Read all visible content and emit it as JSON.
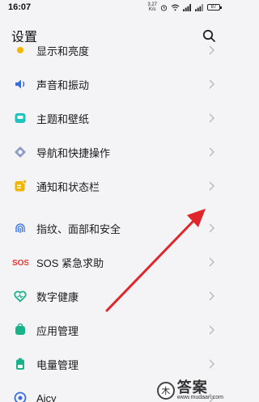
{
  "status_bar": {
    "time": "16:07",
    "net_speed_value": "3.27",
    "net_speed_unit": "K/s",
    "battery": "87"
  },
  "header": {
    "title": "设置",
    "search_icon": "search-icon"
  },
  "items": [
    {
      "label": "显示和亮度",
      "icon": "display-icon",
      "color": "#f2b705"
    },
    {
      "label": "声音和振动",
      "icon": "speaker-icon",
      "color": "#2f6fe8"
    },
    {
      "label": "主题和壁纸",
      "icon": "theme-icon",
      "color": "#1ec5c0"
    },
    {
      "label": "导航和快捷操作",
      "icon": "navigation-icon",
      "color": "#6f7fb4"
    },
    {
      "label": "通知和状态栏",
      "icon": "notification-icon",
      "color": "#f5b400"
    },
    {
      "label": "指纹、面部和安全",
      "icon": "fingerprint-icon",
      "color": "#2f6fe8"
    },
    {
      "label": "SOS 紧急求助",
      "icon": "sos-icon",
      "color": "#e53935"
    },
    {
      "label": "数字健康",
      "icon": "digital-health-icon",
      "color": "#19b38a"
    },
    {
      "label": "应用管理",
      "icon": "app-management-icon",
      "color": "#19b38a"
    },
    {
      "label": "电量管理",
      "icon": "battery-management-icon",
      "color": "#19b38a"
    },
    {
      "label": "Aicy",
      "icon": "aicy-icon",
      "color": "#3b6be0"
    }
  ],
  "watermark": {
    "big": "答案",
    "small": "www.mudaan.com"
  },
  "annotation_color": "#e0262b"
}
